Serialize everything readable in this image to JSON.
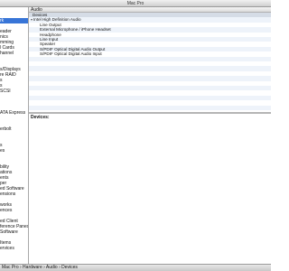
{
  "window": {
    "title": "Mac Pro"
  },
  "sidebar": {
    "items": [
      {
        "label": ""
      },
      {
        "label": ""
      },
      {
        "label": "rk",
        "selected": true
      },
      {
        "label": ""
      },
      {
        "label": "eader"
      },
      {
        "label": "nics"
      },
      {
        "label": "mming"
      },
      {
        "label": "l Cards"
      },
      {
        "label": "hannel"
      },
      {
        "label": ""
      },
      {
        "label": ""
      },
      {
        "label": "s/Displays"
      },
      {
        "label": "re RAID"
      },
      {
        "label": "s"
      },
      {
        "label": "s"
      },
      {
        "label": "SCSI"
      },
      {
        "label": ""
      },
      {
        "label": ""
      },
      {
        "label": ""
      },
      {
        "label": "ATA Express"
      },
      {
        "label": ""
      },
      {
        "label": ""
      },
      {
        "label": "erbolt"
      },
      {
        "label": ""
      },
      {
        "label": ""
      },
      {
        "label": "s"
      },
      {
        "label": "es"
      },
      {
        "label": ""
      },
      {
        "label": ""
      },
      {
        "label": "bility"
      },
      {
        "label": "ations"
      },
      {
        "label": "ents"
      },
      {
        "label": "per"
      },
      {
        "label": "ed Software"
      },
      {
        "label": "ensions"
      },
      {
        "label": ""
      },
      {
        "label": "works"
      },
      {
        "label": "ences"
      },
      {
        "label": ""
      },
      {
        "label": "ed Client"
      },
      {
        "label": "ference Panes"
      },
      {
        "label": "Software"
      },
      {
        "label": ""
      },
      {
        "label": "Items"
      },
      {
        "label": "ervices"
      }
    ]
  },
  "table": {
    "header": "Audio",
    "rows": [
      {
        "label": "Devices",
        "indent": 4,
        "tri": "none",
        "style": "sel"
      },
      {
        "label": "Intel High Definition Audio",
        "indent": 2,
        "tri": "open",
        "style": "stripe"
      },
      {
        "label": "Line Output",
        "indent": 12,
        "tri": "none",
        "style": ""
      },
      {
        "label": "External Microphone / iPhone Headset",
        "indent": 12,
        "tri": "none",
        "style": "stripe"
      },
      {
        "label": "Headphone",
        "indent": 12,
        "tri": "none",
        "style": ""
      },
      {
        "label": "Line Input",
        "indent": 12,
        "tri": "none",
        "style": "stripe"
      },
      {
        "label": "Speaker",
        "indent": 12,
        "tri": "none",
        "style": ""
      },
      {
        "label": "S/PDIF Optical Digital Audio Output",
        "indent": 12,
        "tri": "none",
        "style": "stripe"
      },
      {
        "label": "S/PDIF Optical Digital Audio Input",
        "indent": 12,
        "tri": "none",
        "style": ""
      },
      {
        "label": "",
        "indent": 0,
        "tri": "none",
        "style": "stripe"
      },
      {
        "label": "",
        "indent": 0,
        "tri": "none",
        "style": ""
      },
      {
        "label": "",
        "indent": 0,
        "tri": "none",
        "style": "stripe"
      },
      {
        "label": "",
        "indent": 0,
        "tri": "none",
        "style": ""
      },
      {
        "label": "",
        "indent": 0,
        "tri": "none",
        "style": "stripe"
      },
      {
        "label": "",
        "indent": 0,
        "tri": "none",
        "style": ""
      },
      {
        "label": "",
        "indent": 0,
        "tri": "none",
        "style": "stripe"
      },
      {
        "label": "",
        "indent": 0,
        "tri": "none",
        "style": ""
      },
      {
        "label": "",
        "indent": 0,
        "tri": "none",
        "style": "stripe"
      },
      {
        "label": "",
        "indent": 0,
        "tri": "none",
        "style": ""
      },
      {
        "label": "",
        "indent": 0,
        "tri": "none",
        "style": "stripe"
      }
    ]
  },
  "detail": {
    "heading": "Devices:"
  },
  "statusbar": {
    "path": "Mac Pro › Hardware › Audio › Devices"
  },
  "colors": {
    "selection": "#3875d7",
    "stripe": "#eef3fa",
    "selected_row": "#d5dce6"
  }
}
